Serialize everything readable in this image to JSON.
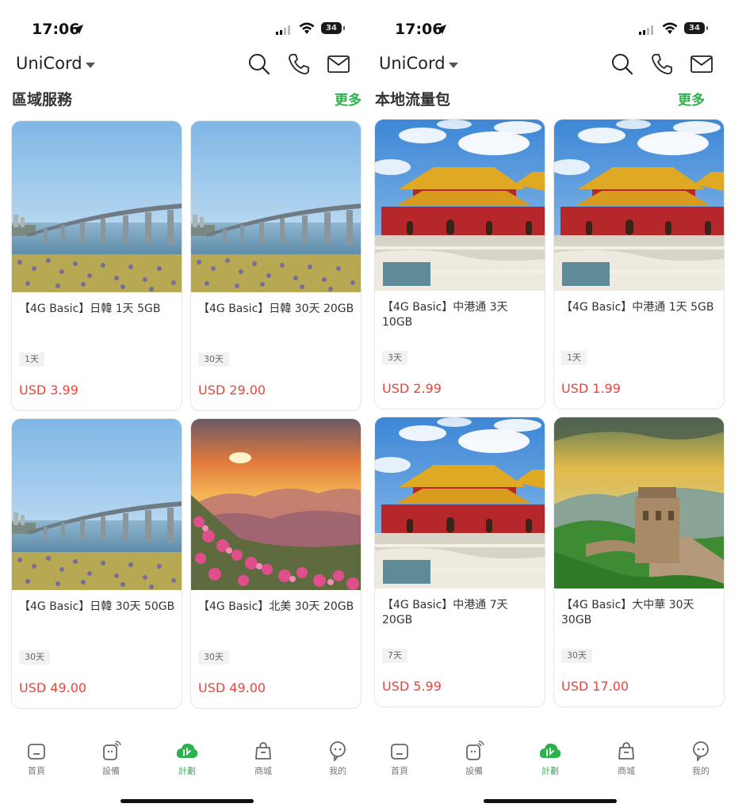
{
  "left": {
    "status": {
      "time": "17:06",
      "battery": "34"
    },
    "header": {
      "brand": "UniCord"
    },
    "section": {
      "title": "區域服務",
      "more": "更多"
    },
    "cards": [
      {
        "name": "【4G Basic】日韓 1天 5GB",
        "tag": "1天",
        "price": "USD 3.99",
        "image": "bridge-lake"
      },
      {
        "name": "【4G Basic】日韓 30天 20GB",
        "tag": "30天",
        "price": "USD 29.00",
        "image": "bridge-lake"
      },
      {
        "name": "【4G Basic】日韓 30天 50GB",
        "tag": "30天",
        "price": "USD 49.00",
        "image": "bridge-lake"
      },
      {
        "name": "【4G Basic】北美 30天 20GB",
        "tag": "30天",
        "price": "USD 49.00",
        "image": "sunset-mountains"
      }
    ],
    "tabs": [
      {
        "label": "首頁",
        "icon": "home-icon"
      },
      {
        "label": "設備",
        "icon": "device-icon"
      },
      {
        "label": "計劃",
        "icon": "plan-icon"
      },
      {
        "label": "商城",
        "icon": "shop-icon"
      },
      {
        "label": "我的",
        "icon": "profile-icon"
      }
    ]
  },
  "right": {
    "status": {
      "time": "17:06",
      "battery": "34"
    },
    "header": {
      "brand": "UniCord"
    },
    "section": {
      "title": "本地流量包",
      "more": "更多"
    },
    "cards": [
      {
        "name": "【4G Basic】中港通 3天 10GB",
        "tag": "3天",
        "price": "USD 2.99",
        "image": "forbidden-city"
      },
      {
        "name": "【4G Basic】中港通 1天 5GB",
        "tag": "1天",
        "price": "USD 1.99",
        "image": "forbidden-city"
      },
      {
        "name": "【4G Basic】中港通 7天 20GB",
        "tag": "7天",
        "price": "USD 5.99",
        "image": "forbidden-city"
      },
      {
        "name": "【4G Basic】大中華 30天 30GB",
        "tag": "30天",
        "price": "USD 17.00",
        "image": "great-wall"
      }
    ],
    "tabs": [
      {
        "label": "首頁",
        "icon": "home-icon"
      },
      {
        "label": "設備",
        "icon": "device-icon"
      },
      {
        "label": "計劃",
        "icon": "plan-icon"
      },
      {
        "label": "商城",
        "icon": "shop-icon"
      },
      {
        "label": "我的",
        "icon": "profile-icon"
      }
    ]
  },
  "colors": {
    "accent": "#2bb24c",
    "price": "#e8453c"
  }
}
